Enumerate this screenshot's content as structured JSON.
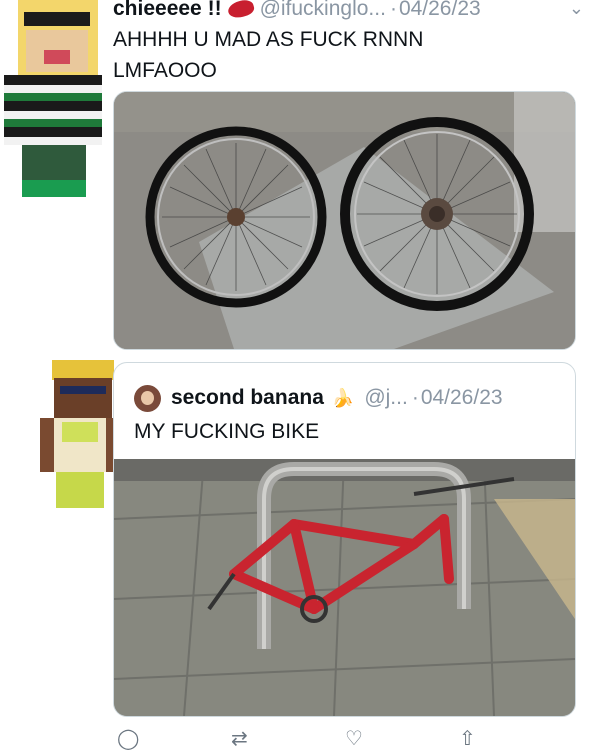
{
  "tweet": {
    "display_name": "chieeeee !!",
    "handle": "@ifuckinglo...",
    "separator": "·",
    "date": "04/26/23",
    "text_line1": "AHHHH U MAD AS FUCK RNNN",
    "text_line2": "LMFAOOO",
    "menu_icon": "chevron-down-icon"
  },
  "quoted_tweet": {
    "display_name": "second banana",
    "emoji": "🍌",
    "handle": "@j...",
    "separator": "·",
    "date": "04/26/23",
    "text": "MY FUCKING BIKE"
  },
  "actions": {
    "reply_icon": "reply-icon",
    "retweet_icon": "retweet-icon",
    "like_icon": "heart-icon",
    "share_icon": "share-icon"
  },
  "colors": {
    "text": "#0f1419",
    "secondary": "#8a96a3",
    "border": "#cfd9de",
    "bike_red": "#c9242f"
  }
}
